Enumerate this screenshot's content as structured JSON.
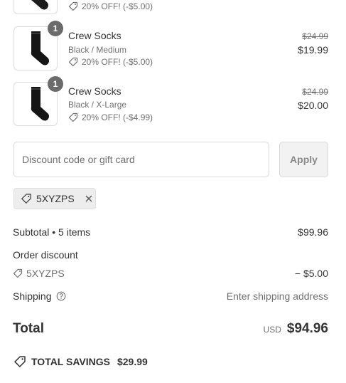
{
  "items": [
    {
      "quantity": "",
      "name": "",
      "variant": "",
      "discount_label": "20% OFF! (-$5.00)",
      "original_price": "",
      "price": ""
    },
    {
      "quantity": "1",
      "name": "Crew Socks",
      "variant": "Black / Medium",
      "discount_label": "20% OFF! (-$5.00)",
      "original_price": "$24.99",
      "price": "$19.99"
    },
    {
      "quantity": "1",
      "name": "Crew Socks",
      "variant": "Black / X-Large",
      "discount_label": "20% OFF! (-$4.99)",
      "original_price": "$24.99",
      "price": "$20.00"
    }
  ],
  "discount": {
    "placeholder": "Discount code or gift card",
    "apply_label": "Apply",
    "applied_code": "5XYZPS"
  },
  "summary": {
    "subtotal_label": "Subtotal • 5 items",
    "subtotal_value": "$99.96",
    "order_discount_label": "Order discount",
    "order_discount_code": "5XYZPS",
    "order_discount_value": "− $5.00",
    "shipping_label": "Shipping",
    "shipping_value": "Enter shipping address",
    "total_label": "Total",
    "currency": "USD",
    "total_value": "$94.96",
    "savings_label": "TOTAL SAVINGS",
    "savings_value": "$29.99"
  },
  "icons": [
    "tag-icon",
    "close-icon",
    "help-circle-icon",
    "sock-image"
  ],
  "colors": {
    "badge": "#6b6b6b",
    "muted": "#707070",
    "apply_bg": "#f2f2f2",
    "chip_bg": "#ededed"
  }
}
